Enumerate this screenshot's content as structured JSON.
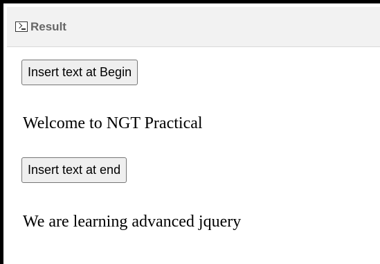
{
  "header": {
    "icon": "terminal-icon",
    "title": "Result"
  },
  "content": {
    "button_begin_label": "Insert text at Begin",
    "paragraph_1": "Welcome to NGT Practical",
    "button_end_label": "Insert text at end",
    "paragraph_2": "We are learning advanced jquery"
  }
}
